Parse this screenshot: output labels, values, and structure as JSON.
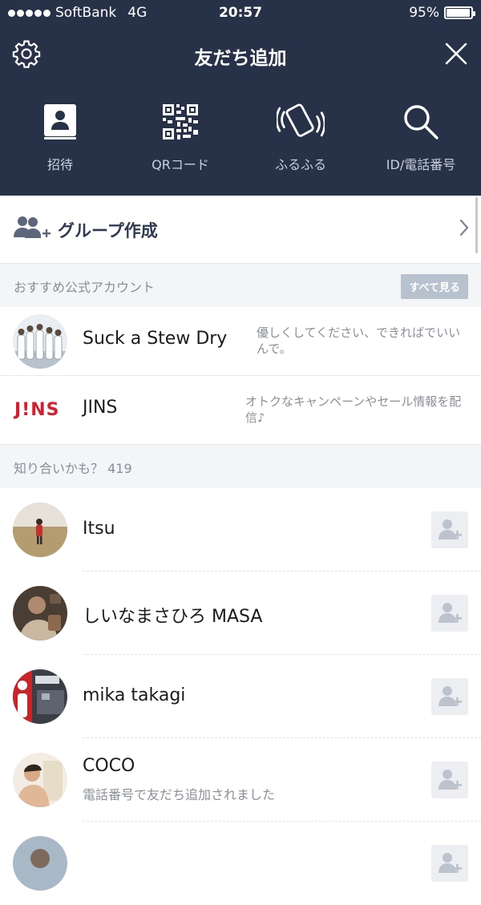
{
  "status_bar": {
    "carrier": "SoftBank",
    "network": "4G",
    "time": "20:57",
    "battery": "95%",
    "battery_level": 0.95
  },
  "header": {
    "title": "友だち追加"
  },
  "actions": [
    {
      "label": "招待",
      "icon": "contact-book-icon"
    },
    {
      "label": "QRコード",
      "icon": "qr-code-icon"
    },
    {
      "label": "ふるふる",
      "icon": "shake-phone-icon"
    },
    {
      "label": "ID/電話番号",
      "icon": "search-icon"
    }
  ],
  "group_create": {
    "label": "グループ作成"
  },
  "official_section": {
    "title": "おすすめ公式アカウント",
    "see_all": "すべて見る",
    "accounts": [
      {
        "name": "Suck a Stew Dry",
        "description": "優しくしてください、できればでいいんで。"
      },
      {
        "name": "JINS",
        "logo_text": "J!NS",
        "description": "オトクなキャンペーンやセール情報を配信♪"
      }
    ]
  },
  "people_section": {
    "title": "知り合いかも？ 419",
    "people": [
      {
        "name": "Itsu",
        "sub": ""
      },
      {
        "name": "しいなまさひろ MASA",
        "sub": ""
      },
      {
        "name": "mika takagi",
        "sub": ""
      },
      {
        "name": "COCO",
        "sub": "電話番号で友だち追加されました"
      }
    ]
  },
  "colors": {
    "header_bg": "#273248",
    "jins_red": "#d3202f",
    "see_all_bg": "#b8c2cf"
  }
}
